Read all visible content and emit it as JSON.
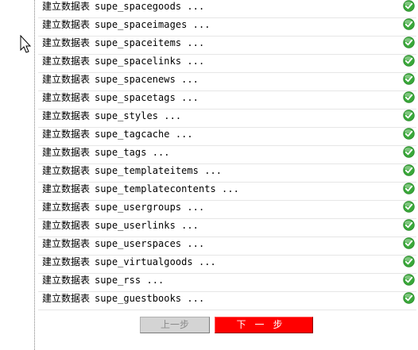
{
  "rows": [
    {
      "prefix": "建立数据表",
      "table": "supe_spacegoods ..."
    },
    {
      "prefix": "建立数据表",
      "table": "supe_spaceimages ..."
    },
    {
      "prefix": "建立数据表",
      "table": "supe_spaceitems ..."
    },
    {
      "prefix": "建立数据表",
      "table": "supe_spacelinks ..."
    },
    {
      "prefix": "建立数据表",
      "table": "supe_spacenews ..."
    },
    {
      "prefix": "建立数据表",
      "table": "supe_spacetags ..."
    },
    {
      "prefix": "建立数据表",
      "table": "supe_styles ..."
    },
    {
      "prefix": "建立数据表",
      "table": "supe_tagcache ..."
    },
    {
      "prefix": "建立数据表",
      "table": "supe_tags ..."
    },
    {
      "prefix": "建立数据表",
      "table": "supe_templateitems ..."
    },
    {
      "prefix": "建立数据表",
      "table": "supe_templatecontents ..."
    },
    {
      "prefix": "建立数据表",
      "table": "supe_usergroups ..."
    },
    {
      "prefix": "建立数据表",
      "table": "supe_userlinks ..."
    },
    {
      "prefix": "建立数据表",
      "table": "supe_userspaces ..."
    },
    {
      "prefix": "建立数据表",
      "table": "supe_virtualgoods ..."
    },
    {
      "prefix": "建立数据表",
      "table": "supe_rss ..."
    },
    {
      "prefix": "建立数据表",
      "table": "supe_guestbooks ..."
    }
  ],
  "status_icon": "check-circle-icon",
  "colors": {
    "check_green": "#3aa83a",
    "next_button_bg": "#ff0000",
    "prev_button_bg": "#d4d4d4",
    "row_divider": "#e6e6e6"
  },
  "buttons": {
    "prev_label": "上一步",
    "next_label": "下一步"
  }
}
